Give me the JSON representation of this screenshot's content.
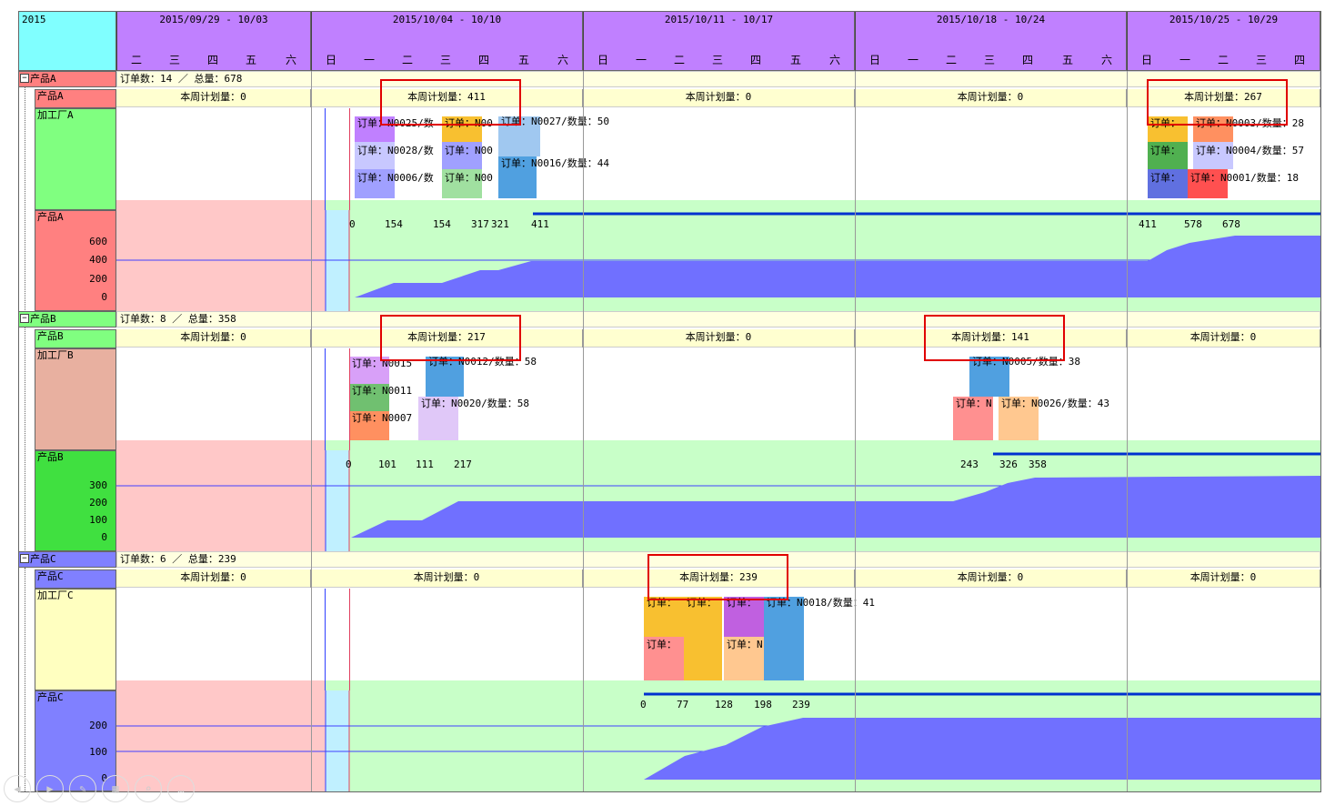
{
  "year": "2015",
  "weeks": [
    {
      "label": "2015/09/29 - 10/03",
      "days": [
        "二",
        "三",
        "四",
        "五",
        "六"
      ]
    },
    {
      "label": "2015/10/04 - 10/10",
      "days": [
        "日",
        "一",
        "二",
        "三",
        "四",
        "五",
        "六"
      ]
    },
    {
      "label": "2015/10/11 - 10/17",
      "days": [
        "日",
        "一",
        "二",
        "三",
        "四",
        "五",
        "六"
      ]
    },
    {
      "label": "2015/10/18 - 10/24",
      "days": [
        "日",
        "一",
        "二",
        "三",
        "四",
        "五",
        "六"
      ]
    },
    {
      "label": "2015/10/25 - 10/29",
      "days": [
        "日",
        "一",
        "二",
        "三",
        "四"
      ]
    }
  ],
  "groups": [
    {
      "name": "产品A",
      "summary": "订单数：14  ／  总量：678",
      "product_row": "产品A",
      "factory": "加工厂A",
      "chart_label": "产品A",
      "plans": [
        "本周计划量：0",
        "本周计划量：411",
        "本周计划量：0",
        "本周计划量：0",
        "本周计划量：267"
      ],
      "orders": [
        "订单：N0025/数",
        "订单：N00",
        "订单：N0027/数量：50",
        "订单：N0028/数",
        "订单：N00",
        "订单：N0016/数量：44",
        "订单：N0006/数",
        "订单：N00",
        "订单：",
        "订单：N0003/数量：28",
        "订单：",
        "订单：N0004/数量：57",
        "订单：",
        "订单：N0001/数量：18"
      ],
      "cumulative": [
        "0",
        "154",
        "154",
        "317",
        "321",
        "411",
        "411",
        "578",
        "678"
      ],
      "y_ticks": [
        "600",
        "400",
        "200",
        "0"
      ]
    },
    {
      "name": "产品B",
      "summary": "订单数：8  ／  总量：358",
      "product_row": "产品B",
      "factory": "加工厂B",
      "chart_label": "产品B",
      "plans": [
        "本周计划量：0",
        "本周计划量：217",
        "本周计划量：0",
        "本周计划量：141",
        "本周计划量：0"
      ],
      "orders": [
        "订单：N0015",
        "订单：N0012/数量：58",
        "订单：N0011",
        "订单：N0020/数量：58",
        "订单：N0007",
        "订单：N0005/数量：38",
        "订单：N",
        "订单：N0026/数量：43"
      ],
      "cumulative": [
        "0",
        "101",
        "111",
        "217",
        "243",
        "326",
        "358"
      ],
      "y_ticks": [
        "300",
        "200",
        "100",
        "0"
      ]
    },
    {
      "name": "产品C",
      "summary": "订单数：6  ／  总量：239",
      "product_row": "产品C",
      "factory": "加工厂C",
      "chart_label": "产品C",
      "plans": [
        "本周计划量：0",
        "本周计划量：0",
        "本周计划量：239",
        "本周计划量：0",
        "本周计划量：0"
      ],
      "orders": [
        "订单：",
        "订单：",
        "订单：",
        "订单：N0018/数量：41",
        "订单：",
        "订单：N"
      ],
      "cumulative": [
        "0",
        "77",
        "128",
        "198",
        "239"
      ],
      "y_ticks": [
        "200",
        "100",
        "0"
      ]
    }
  ],
  "colors": {
    "header_week": "#c080ff",
    "header_year": "#80ffff",
    "product_a": "#ff8080",
    "product_b": "#80ff80",
    "product_c": "#8080ff",
    "factory_c": "#ffffc0",
    "area_fill": "#7070ff",
    "highlight_box": "#e00000"
  }
}
